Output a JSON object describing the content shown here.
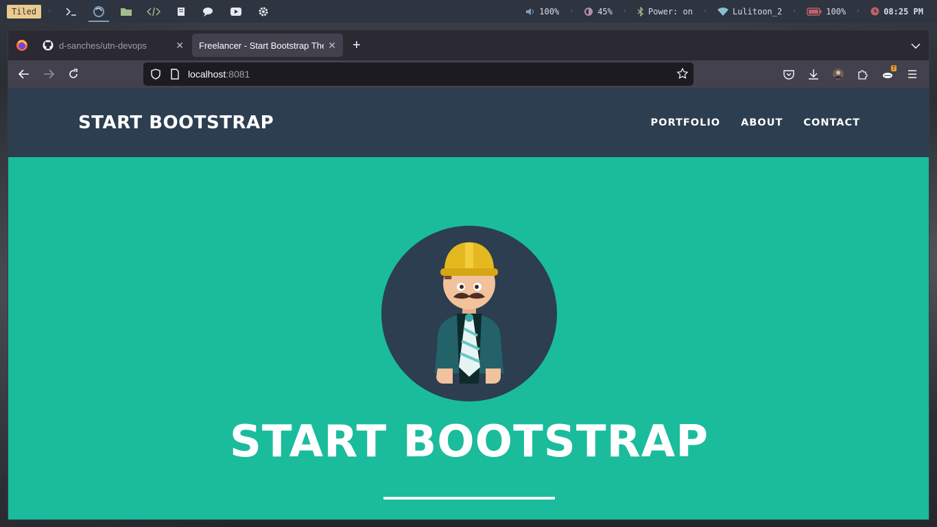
{
  "topbar": {
    "layout_mode": "Tiled",
    "launchers": [
      "terminal-icon",
      "firefox-icon",
      "folder-icon",
      "code-icon",
      "book-icon",
      "chat-icon",
      "youtube-icon",
      "settings-icon"
    ],
    "volume": "100%",
    "brightness": "45%",
    "bluetooth": "Power: on",
    "wifi": "Lulitoon_2",
    "battery": "100%",
    "clock": "08:25 PM"
  },
  "browser": {
    "tabs": [
      {
        "label": "d-sanches/utn-devops",
        "active": false
      },
      {
        "label": "Freelancer - Start Bootstrap Theme",
        "active": true
      }
    ],
    "url": {
      "host": "localhost",
      "port": ":8081"
    },
    "extension_badge": "7"
  },
  "site": {
    "brand": "START BOOTSTRAP",
    "menu": [
      "PORTFOLIO",
      "ABOUT",
      "CONTACT"
    ],
    "hero_title": "START BOOTSTRAP"
  },
  "colors": {
    "nav": "#2c3e50",
    "hero": "#1abc9c",
    "accent": "#ebcb8b"
  }
}
